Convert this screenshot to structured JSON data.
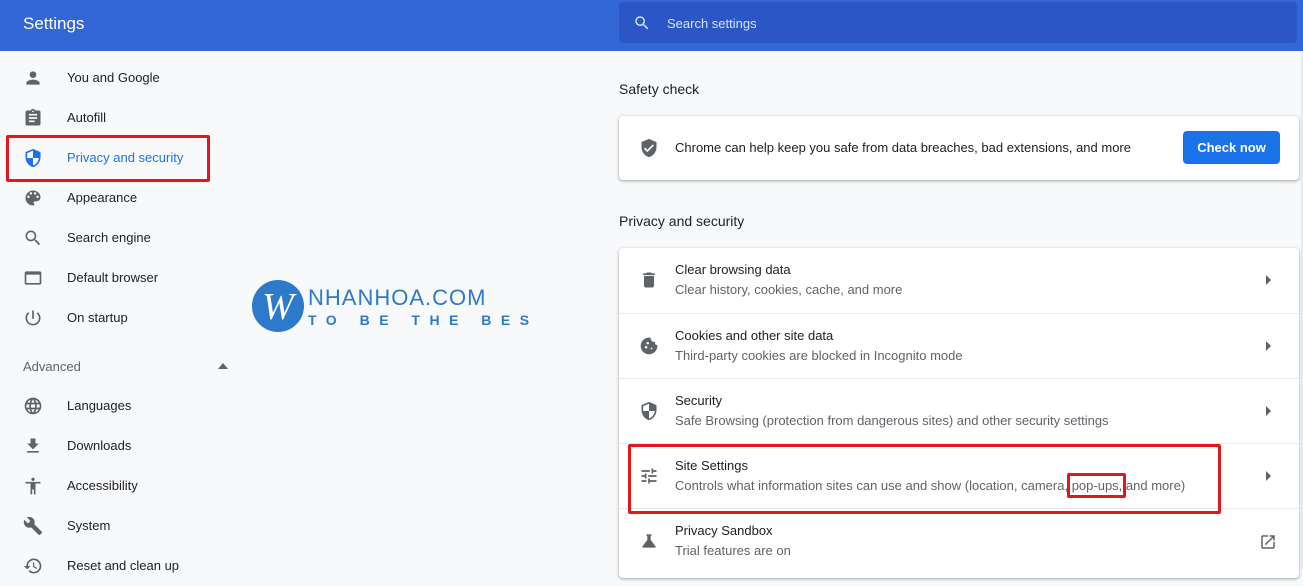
{
  "app": {
    "title": "Settings"
  },
  "search": {
    "placeholder": "Search settings"
  },
  "sidebar": {
    "items": [
      {
        "label": "You and Google",
        "icon": "person-icon"
      },
      {
        "label": "Autofill",
        "icon": "clipboard-icon"
      },
      {
        "label": "Privacy and security",
        "icon": "shield-icon",
        "active": true
      },
      {
        "label": "Appearance",
        "icon": "palette-icon"
      },
      {
        "label": "Search engine",
        "icon": "search-icon"
      },
      {
        "label": "Default browser",
        "icon": "browser-icon"
      },
      {
        "label": "On startup",
        "icon": "power-icon"
      }
    ],
    "advanced_label": "Advanced",
    "advanced_items": [
      {
        "label": "Languages",
        "icon": "globe-icon"
      },
      {
        "label": "Downloads",
        "icon": "download-icon"
      },
      {
        "label": "Accessibility",
        "icon": "accessibility-icon"
      },
      {
        "label": "System",
        "icon": "wrench-icon"
      },
      {
        "label": "Reset and clean up",
        "icon": "history-icon"
      }
    ]
  },
  "watermark": {
    "brand": "NHANHOA.COM",
    "tagline": "TO BE THE BEST"
  },
  "safety_check": {
    "section_title": "Safety check",
    "text": "Chrome can help keep you safe from data breaches, bad extensions, and more",
    "button_label": "Check now"
  },
  "privacy": {
    "section_title": "Privacy and security",
    "rows": [
      {
        "title": "Clear browsing data",
        "subtitle": "Clear history, cookies, cache, and more",
        "icon": "trash-icon"
      },
      {
        "title": "Cookies and other site data",
        "subtitle": "Third-party cookies are blocked in Incognito mode",
        "icon": "cookie-icon"
      },
      {
        "title": "Security",
        "subtitle": "Safe Browsing (protection from dangerous sites) and other security settings",
        "icon": "shield-icon"
      },
      {
        "title": "Site Settings",
        "subtitle": "Controls what information sites can use and show (location, camera, pop-ups, and more)",
        "icon": "tune-icon"
      },
      {
        "title": "Privacy Sandbox",
        "subtitle": "Trial features are on",
        "icon": "flask-icon"
      }
    ]
  },
  "colors": {
    "header": "#3367d6",
    "accent": "#1a73e8",
    "highlight": "#e0181c",
    "logo_blue": "#2c7ac9",
    "logo_orange": "#f28c1b"
  }
}
